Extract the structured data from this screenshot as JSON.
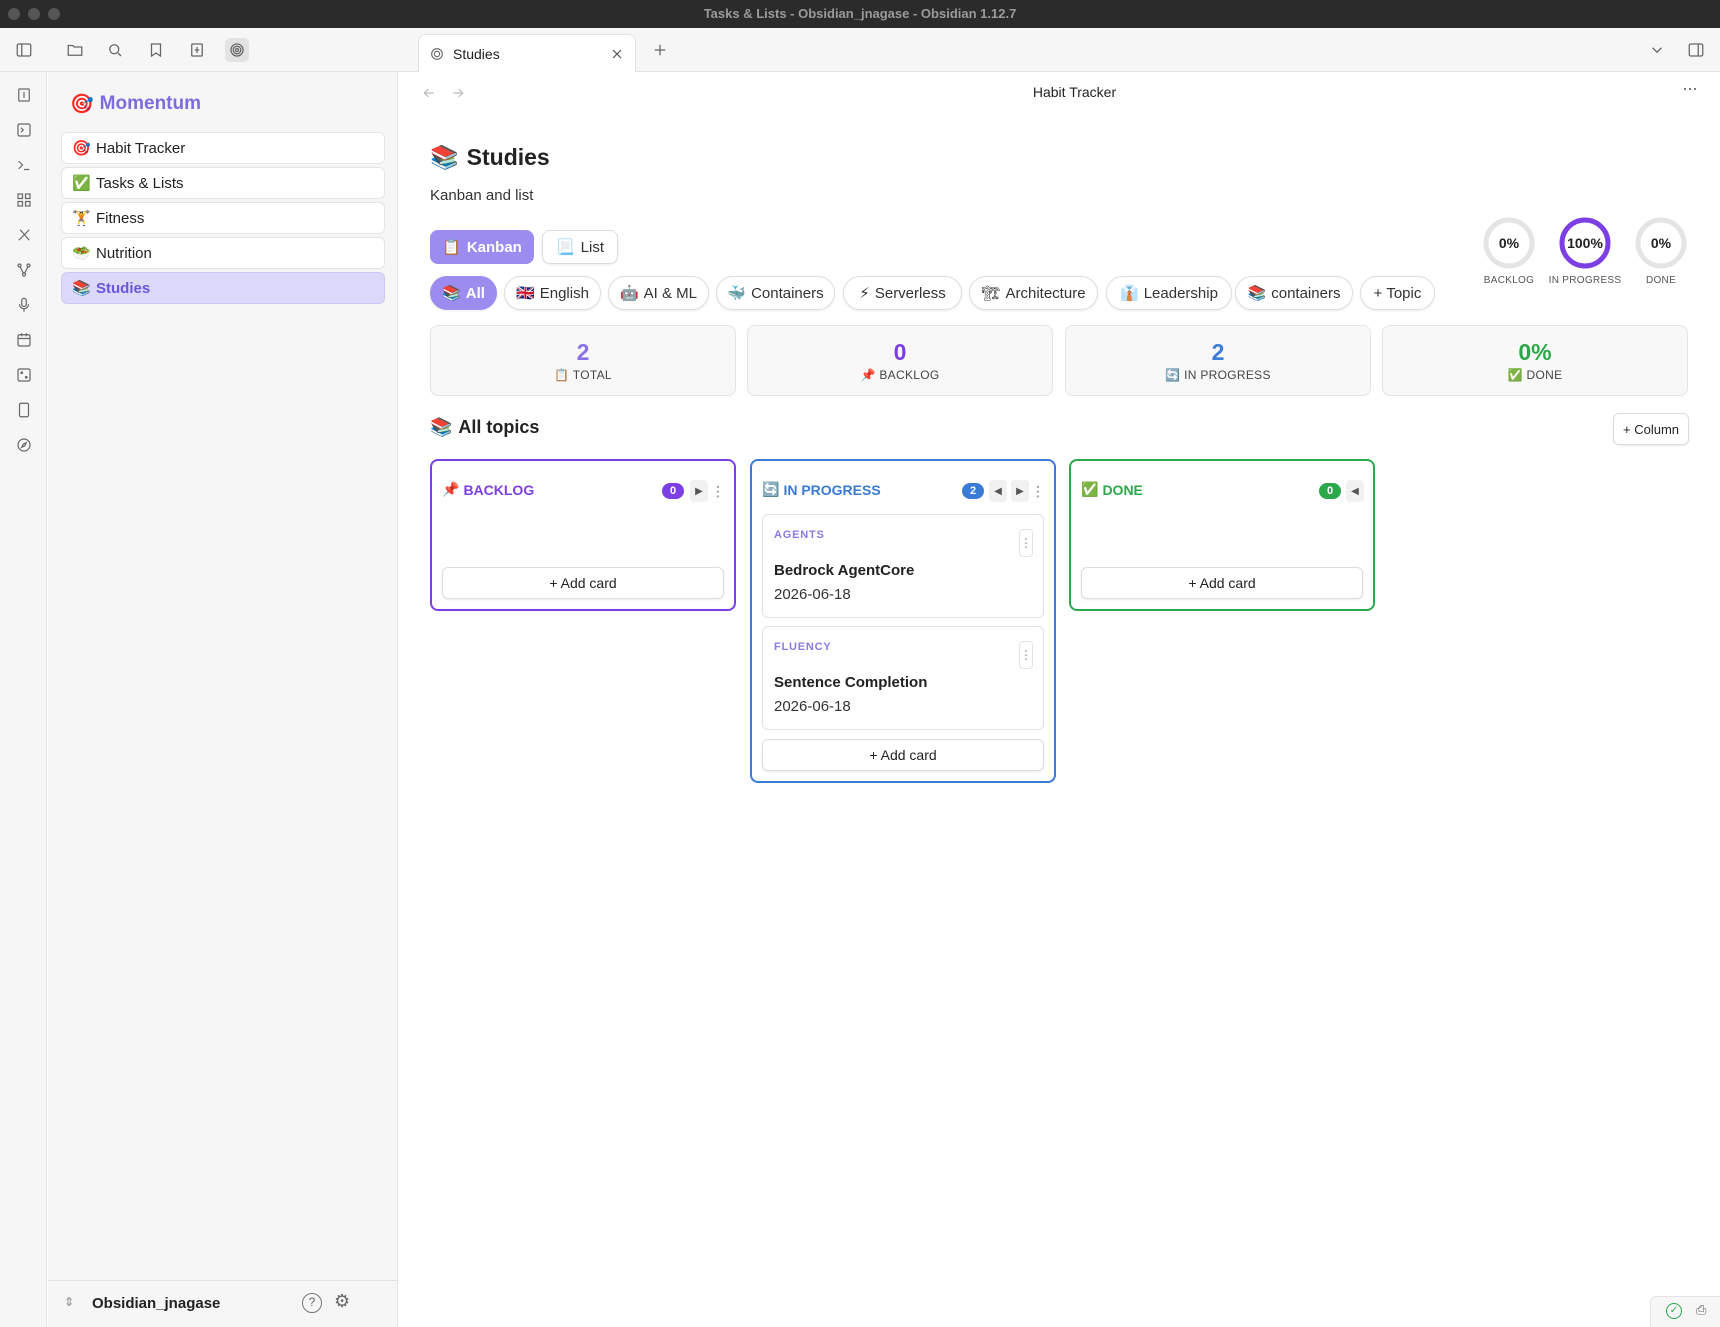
{
  "window": {
    "title": "Tasks & Lists - Obsidian_jnagase - Obsidian 1.12.7"
  },
  "tab": {
    "label": "Studies"
  },
  "header": {
    "title": "Habit Tracker",
    "more": "···"
  },
  "sidebar": {
    "title": "Momentum",
    "items": [
      {
        "emoji": "🎯",
        "label": "Habit Tracker"
      },
      {
        "emoji": "✅",
        "label": "Tasks & Lists"
      },
      {
        "emoji": "🏋",
        "label": "Fitness"
      },
      {
        "emoji": "🥗",
        "label": "Nutrition"
      },
      {
        "emoji": "📚",
        "label": "Studies"
      }
    ],
    "vault": "Obsidian_jnagase"
  },
  "page": {
    "emoji": "📚",
    "title": "Studies",
    "subtitle": "Kanban and list",
    "views": [
      {
        "emoji": "📋",
        "label": "Kanban"
      },
      {
        "emoji": "📃",
        "label": "List"
      }
    ],
    "topics": [
      {
        "emoji": "📚",
        "label": "All"
      },
      {
        "emoji": "🇬🇧",
        "label": "English"
      },
      {
        "emoji": "🤖",
        "label": "AI & ML"
      },
      {
        "emoji": "🐳",
        "label": "Containers"
      },
      {
        "emoji": "⚡",
        "label": "Serverless"
      },
      {
        "emoji": "🏗",
        "label": "Architecture"
      },
      {
        "emoji": "👔",
        "label": "Leadership"
      },
      {
        "emoji": "📚",
        "label": "containers"
      },
      {
        "emoji": "",
        "label": "+ Topic"
      }
    ],
    "rings": [
      {
        "value": "0%",
        "label": "BACKLOG",
        "fraction": 0
      },
      {
        "value": "100%",
        "label": "IN PROGRESS",
        "fraction": 1
      },
      {
        "value": "0%",
        "label": "DONE",
        "fraction": 0
      }
    ],
    "stats": [
      {
        "num": "2",
        "emoji": "📋",
        "label": "TOTAL",
        "color": "#8a73e6"
      },
      {
        "num": "0",
        "emoji": "📌",
        "label": "BACKLOG",
        "color": "#7b3fe4"
      },
      {
        "num": "2",
        "emoji": "🔄",
        "label": "IN PROGRESS",
        "color": "#3a7bd5"
      },
      {
        "num": "0%",
        "emoji": "✅",
        "label": "DONE",
        "color": "#2aa84a"
      }
    ],
    "section_emoji": "📚",
    "section_title": "All topics",
    "add_column": "+ Column",
    "columns": [
      {
        "emoji": "📌",
        "title": "BACKLOG",
        "count": "0",
        "color": "#7b3fe4",
        "add_card": "+ Add card",
        "cards": []
      },
      {
        "emoji": "🔄",
        "title": "IN PROGRESS",
        "count": "2",
        "color": "#3a7bd5",
        "add_card": "+ Add card",
        "cards": [
          {
            "tag": "AGENTS",
            "title": "Bedrock AgentCore",
            "date": "2026-06-18"
          },
          {
            "tag": "FLUENCY",
            "title": "Sentence Completion",
            "date": "2026-06-18"
          }
        ]
      },
      {
        "emoji": "✅",
        "title": "DONE",
        "count": "0",
        "color": "#2aa84a",
        "add_card": "+ Add card",
        "cards": []
      }
    ]
  },
  "colors": {
    "accent": "#7c6cdc",
    "backlog": "#7b3fe4",
    "in_progress": "#3a7bd5",
    "done": "#2aa84a"
  }
}
